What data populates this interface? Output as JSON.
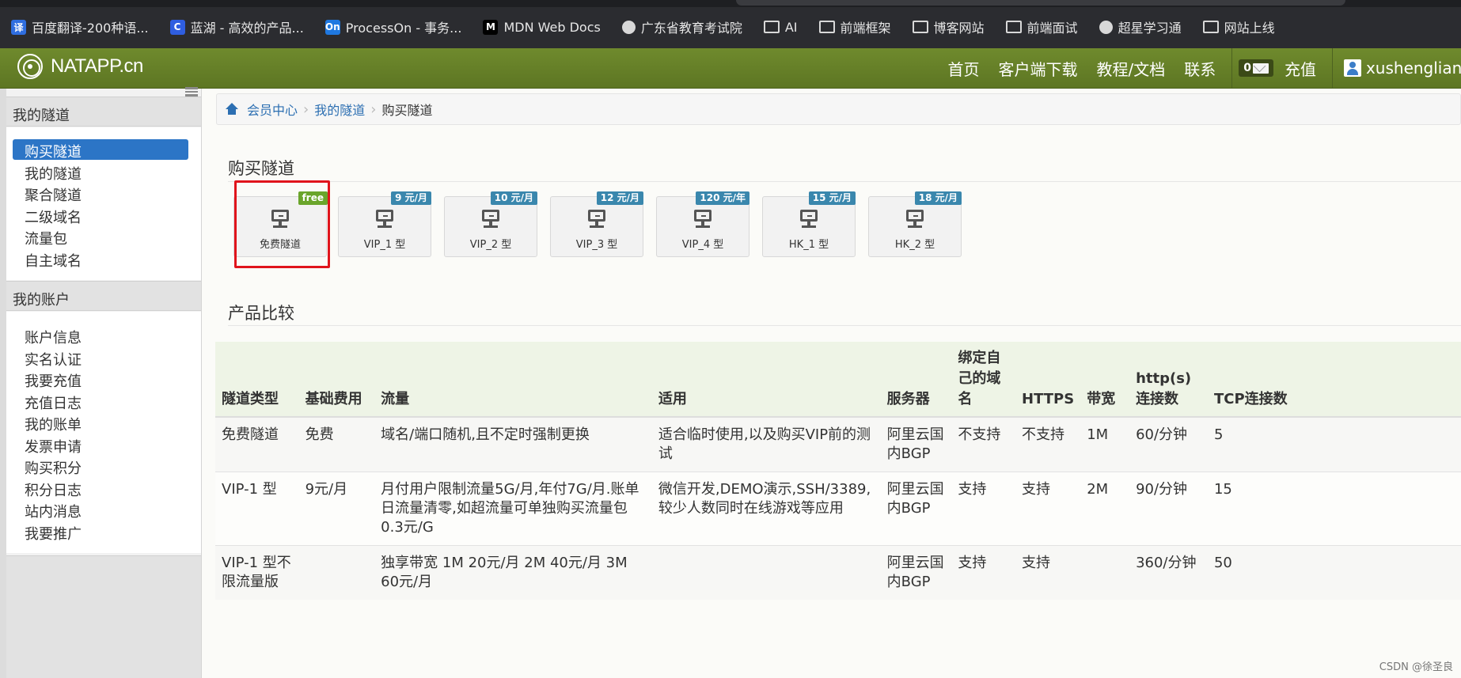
{
  "bookmarks": [
    {
      "label": "百度翻译-200种语...",
      "icon": "baidu-translate-icon",
      "glyph": "译",
      "color": "#2f6ee0"
    },
    {
      "label": "蓝湖 - 高效的产品...",
      "icon": "lanhu-icon",
      "glyph": "C",
      "color": "#2f5ee0"
    },
    {
      "label": "ProcessOn - 事务...",
      "icon": "processon-icon",
      "glyph": "On",
      "color": "#1f78e0"
    },
    {
      "label": "MDN Web Docs",
      "icon": "mdn-icon",
      "glyph": "M",
      "color": "#000000"
    },
    {
      "label": "广东省教育考试院",
      "icon": "globe-icon",
      "glyph": "",
      "color": ""
    },
    {
      "label": "AI",
      "icon": "folder-icon",
      "glyph": "",
      "color": ""
    },
    {
      "label": "前端框架",
      "icon": "folder-icon",
      "glyph": "",
      "color": ""
    },
    {
      "label": "博客网站",
      "icon": "folder-icon",
      "glyph": "",
      "color": ""
    },
    {
      "label": "前端面试",
      "icon": "folder-icon",
      "glyph": "",
      "color": ""
    },
    {
      "label": "超星学习通",
      "icon": "globe-icon",
      "glyph": "",
      "color": ""
    },
    {
      "label": "网站上线",
      "icon": "folder-icon",
      "glyph": "",
      "color": ""
    }
  ],
  "navbar": {
    "brand": "NATAPP.cn",
    "links": [
      "首页",
      "客户端下载",
      "教程/文档",
      "联系"
    ],
    "msg_count": "0",
    "recharge": "充值",
    "username": "xushengliang"
  },
  "sidebar": {
    "section1": "我的隧道",
    "section1_items": [
      "购买隧道",
      "我的隧道",
      "聚合隧道",
      "二级域名",
      "流量包",
      "自主域名"
    ],
    "section2": "我的账户",
    "section2_items": [
      "账户信息",
      "实名认证",
      "我要充值",
      "充值日志",
      "我的账单",
      "发票申请",
      "购买积分",
      "积分日志",
      "站内消息",
      "我要推广"
    ]
  },
  "breadcrumb": {
    "items": [
      "会员中心",
      "我的隧道"
    ],
    "current": "购买隧道"
  },
  "buy": {
    "title": "购买隧道",
    "cards": [
      {
        "label": "免费隧道",
        "badge": "free"
      },
      {
        "label": "VIP_1 型",
        "badge": "9 元/月"
      },
      {
        "label": "VIP_2 型",
        "badge": "10 元/月"
      },
      {
        "label": "VIP_3 型",
        "badge": "12 元/月"
      },
      {
        "label": "VIP_4 型",
        "badge": "120 元/年"
      },
      {
        "label": "HK_1 型",
        "badge": "15 元/月"
      },
      {
        "label": "HK_2 型",
        "badge": "18 元/月"
      }
    ]
  },
  "compare": {
    "title": "产品比较",
    "headers": [
      "隧道类型",
      "基础费用",
      "流量",
      "适用",
      "服务器",
      "绑定自己的域名",
      "HTTPS",
      "带宽",
      "http(s)连接数",
      "TCP连接数"
    ],
    "rows": [
      [
        "免费隧道",
        "免费",
        "域名/端口随机,且不定时强制更换",
        "适合临时使用,以及购买VIP前的测试",
        "阿里云国内BGP",
        "不支持",
        "不支持",
        "1M",
        "60/分钟",
        "5"
      ],
      [
        "VIP-1 型",
        "9元/月",
        "月付用户限制流量5G/月,年付7G/月.账单日流量清零,如超流量可单独购买流量包 0.3元/G",
        "微信开发,DEMO演示,SSH/3389,较少人数同时在线游戏等应用",
        "阿里云国内BGP",
        "支持",
        "支持",
        "2M",
        "90/分钟",
        "15"
      ],
      [
        "VIP-1 型不限流量版",
        "",
        "独享带宽 1M 20元/月 2M 40元/月 3M 60元/月",
        "",
        "阿里云国内BGP",
        "支持",
        "支持",
        "",
        "360/分钟",
        "50"
      ]
    ]
  },
  "watermark": "CSDN @徐圣良"
}
